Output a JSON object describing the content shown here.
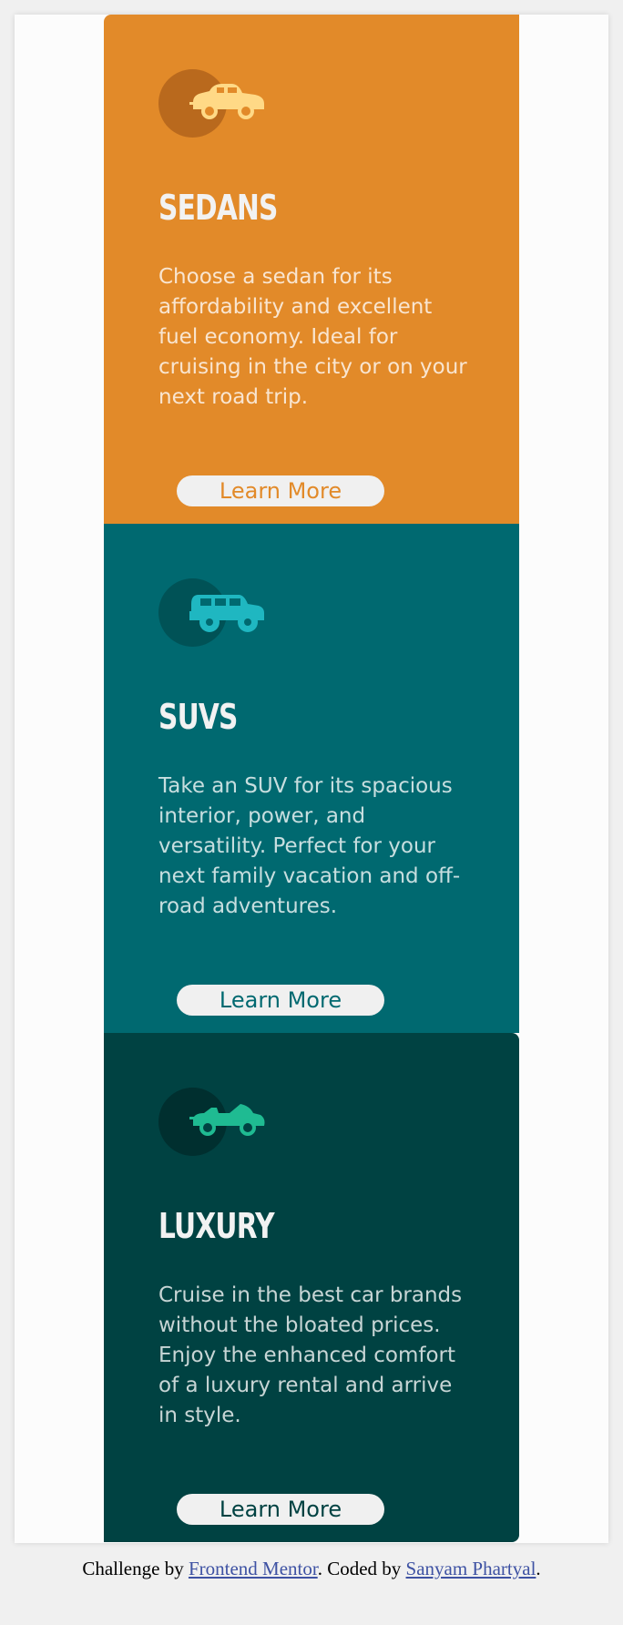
{
  "cards": [
    {
      "title": "SEDANS",
      "text": "Choose a sedan for its affordability and excellent fuel economy. Ideal for cruising in the city or on your next road trip.",
      "button": "Learn More",
      "icon": "sedan-car-icon",
      "color": "#e28a29"
    },
    {
      "title": "SUVS",
      "text": "Take an SUV for its spacious interior, power, and versatility. Perfect for your next family vacation and off-road adventures.",
      "button": "Learn More",
      "icon": "suv-car-icon",
      "color": "#006970"
    },
    {
      "title": "LUXURY",
      "text": "Cruise in the best car brands without the bloated prices. Enjoy the enhanced comfort of a luxury rental and arrive in style.",
      "button": "Learn More",
      "icon": "luxury-car-icon",
      "color": "#004242"
    }
  ],
  "attribution": {
    "prefix": "Challenge by",
    "link1": "Frontend Mentor",
    "middle": ". Coded by",
    "link2": "Sanyam Phartyal",
    "suffix": "."
  }
}
